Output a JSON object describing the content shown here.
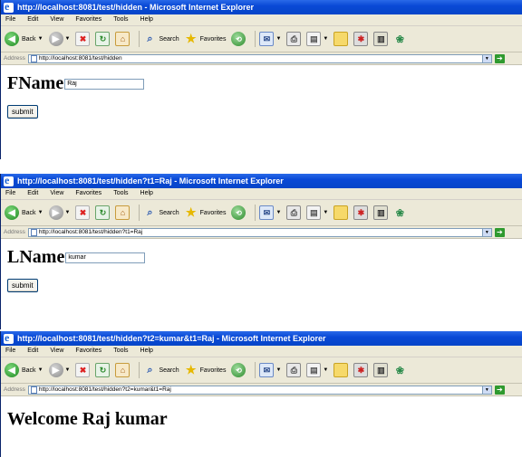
{
  "windows": [
    {
      "title": "http://localhost:8081/test/hidden - Microsoft Internet Explorer",
      "address": "http://localhost:8081/test/hidden",
      "field_label": "FName",
      "field_value": "Raj",
      "submit_label": "submit"
    },
    {
      "title": "http://localhost:8081/test/hidden?t1=Raj - Microsoft Internet Explorer",
      "address": "http://localhost:8081/test/hidden?t1=Raj",
      "field_label": "LName",
      "field_value": "kumar",
      "submit_label": "submit"
    },
    {
      "title": "http://localhost:8081/test/hidden?t2=kumar&t1=Raj - Microsoft Internet Explorer",
      "address": "http://localhost:8081/test/hidden?t2=kumar&t1=Raj",
      "welcome_text": "Welcome Raj kumar"
    }
  ],
  "menu": [
    "File",
    "Edit",
    "View",
    "Favorites",
    "Tools",
    "Help"
  ],
  "toolbar": {
    "back_label": "Back",
    "search_label": "Search",
    "favorites_label": "Favorites"
  },
  "address_label": "Address",
  "go_label": "Go",
  "colors": {
    "titlebar": "#0a49d6",
    "chrome": "#ece9d8",
    "go_button": "#2f9a2f"
  }
}
